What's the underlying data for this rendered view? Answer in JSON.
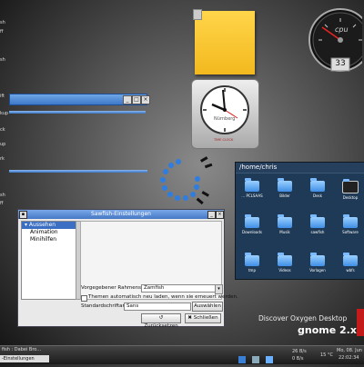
{
  "left_edge_fragments": [
    "sh",
    "ff",
    "sh",
    "ift",
    "kup",
    "ck",
    "up",
    "rk",
    "sh",
    "ff"
  ],
  "mini_window": {
    "buttons": [
      "_",
      "□",
      "×"
    ]
  },
  "cpu_gauge": {
    "label": "cpu",
    "value": "33"
  },
  "clock": {
    "city": "Nürnberg",
    "brand": "TIME CLOCK"
  },
  "home_panel": {
    "path": "/home/chris",
    "folders": [
      {
        "label": "... PCLSAAS"
      },
      {
        "label": "Bilder"
      },
      {
        "label": "Desk"
      },
      {
        "label": "Desktop"
      },
      {
        "label": "Downloads"
      },
      {
        "label": "Musik"
      },
      {
        "label": "sawfish"
      },
      {
        "label": "Software"
      },
      {
        "label": "tmp"
      },
      {
        "label": "Videos"
      },
      {
        "label": "Vorlagen"
      },
      {
        "label": "wbfs"
      }
    ]
  },
  "dialog": {
    "title": "Sawfish-Einstellungen",
    "tree": [
      {
        "label": "Aussehen",
        "selected": true
      },
      {
        "label": "Animation",
        "selected": false
      },
      {
        "label": "Minihilfen",
        "selected": false
      }
    ],
    "frame_style_label": "Vorgegebener Rahmenstil:",
    "frame_style_value": "Zamfish",
    "themes_checkbox_label": "Themen automatisch neu laden, wenn sie erneuert werden.",
    "default_font_label": "Standardschriftart:",
    "default_font_value": "Sans",
    "choose_button": "Auswählen ...",
    "back_button": "Zurücksetzen",
    "close_button": "Schließen"
  },
  "branding": {
    "discover": "Discover Oxygen Desktop",
    "gnome": "gnome 2.x"
  },
  "taskbar": {
    "running_task": "fish : Dabei Bro...",
    "active_task": "-Einstellungen",
    "net_up": "26 B/s",
    "net_down": "0 B/s",
    "temperature": "15 °C",
    "date": "Mo, 08. Jun",
    "time": "22:02:34"
  }
}
